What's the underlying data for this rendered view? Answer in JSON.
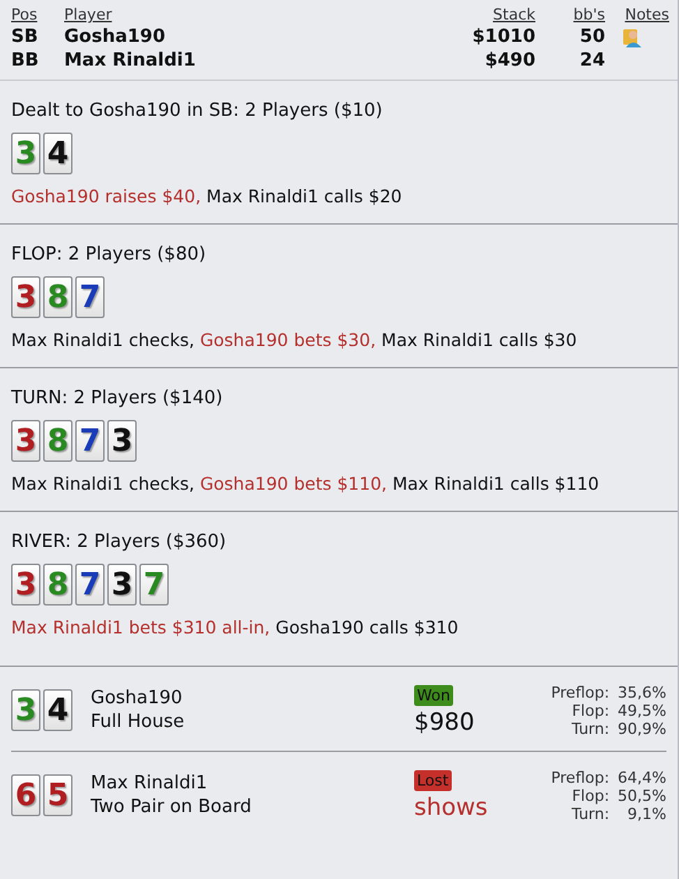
{
  "players_table": {
    "columns": [
      "Pos",
      "Player",
      "Stack",
      "bb's",
      "Notes"
    ],
    "rows": [
      {
        "pos": "SB",
        "player": "Gosha190",
        "stack": "$1010",
        "bbs": "50",
        "has_note": true
      },
      {
        "pos": "BB",
        "player": "Max Rinaldi1",
        "stack": "$490",
        "bbs": "24",
        "has_note": false
      }
    ]
  },
  "streets": [
    {
      "title": "Dealt to Gosha190 in SB: 2 Players ($10)",
      "cards": [
        {
          "rank": "3",
          "color": "#2a8a22"
        },
        {
          "rank": "4",
          "color": "#111111"
        }
      ],
      "actions": [
        {
          "text": "Gosha190 raises $40,",
          "highlighted": true
        },
        {
          "text": "Max Rinaldi1 calls $20",
          "highlighted": false
        }
      ]
    },
    {
      "title": "FLOP: 2 Players ($80)",
      "cards": [
        {
          "rank": "3",
          "color": "#b01e22"
        },
        {
          "rank": "8",
          "color": "#2a8a22"
        },
        {
          "rank": "7",
          "color": "#1a3cb8"
        }
      ],
      "actions": [
        {
          "text": "Max Rinaldi1 checks,",
          "highlighted": false
        },
        {
          "text": "Gosha190 bets $30,",
          "highlighted": true
        },
        {
          "text": "Max Rinaldi1 calls $30",
          "highlighted": false
        }
      ]
    },
    {
      "title": "TURN: 2 Players ($140)",
      "cards": [
        {
          "rank": "3",
          "color": "#b01e22"
        },
        {
          "rank": "8",
          "color": "#2a8a22"
        },
        {
          "rank": "7",
          "color": "#1a3cb8"
        },
        {
          "rank": "3",
          "color": "#111111"
        }
      ],
      "actions": [
        {
          "text": "Max Rinaldi1 checks,",
          "highlighted": false
        },
        {
          "text": "Gosha190 bets $110,",
          "highlighted": true
        },
        {
          "text": "Max Rinaldi1 calls $110",
          "highlighted": false
        }
      ]
    },
    {
      "title": "RIVER: 2 Players ($360)",
      "cards": [
        {
          "rank": "3",
          "color": "#b01e22"
        },
        {
          "rank": "8",
          "color": "#2a8a22"
        },
        {
          "rank": "7",
          "color": "#1a3cb8"
        },
        {
          "rank": "3",
          "color": "#111111"
        },
        {
          "rank": "7",
          "color": "#2a8a22"
        }
      ],
      "actions": [
        {
          "text": "Max Rinaldi1 bets $310 all-in,",
          "highlighted": true
        },
        {
          "text": "Gosha190 calls $310",
          "highlighted": false
        }
      ]
    }
  ],
  "results": [
    {
      "cards": [
        {
          "rank": "3",
          "color": "#2a8a22"
        },
        {
          "rank": "4",
          "color": "#111111"
        }
      ],
      "player": "Gosha190",
      "hand": "Full House",
      "outcome": "Won",
      "kind": "won",
      "amount": "$980",
      "equity": [
        {
          "label": "Preflop:",
          "value": "35,6%"
        },
        {
          "label": "Flop:",
          "value": "49,5%"
        },
        {
          "label": "Turn:",
          "value": "90,9%"
        }
      ]
    },
    {
      "cards": [
        {
          "rank": "6",
          "color": "#b01e22"
        },
        {
          "rank": "5",
          "color": "#b01e22"
        }
      ],
      "player": "Max Rinaldi1",
      "hand": "Two Pair on Board",
      "outcome": "Lost",
      "kind": "lost",
      "amount": "shows",
      "equity": [
        {
          "label": "Preflop:",
          "value": "64,4%"
        },
        {
          "label": "Flop:",
          "value": "50,5%"
        },
        {
          "label": "Turn:",
          "value": "9,1%"
        }
      ]
    }
  ]
}
